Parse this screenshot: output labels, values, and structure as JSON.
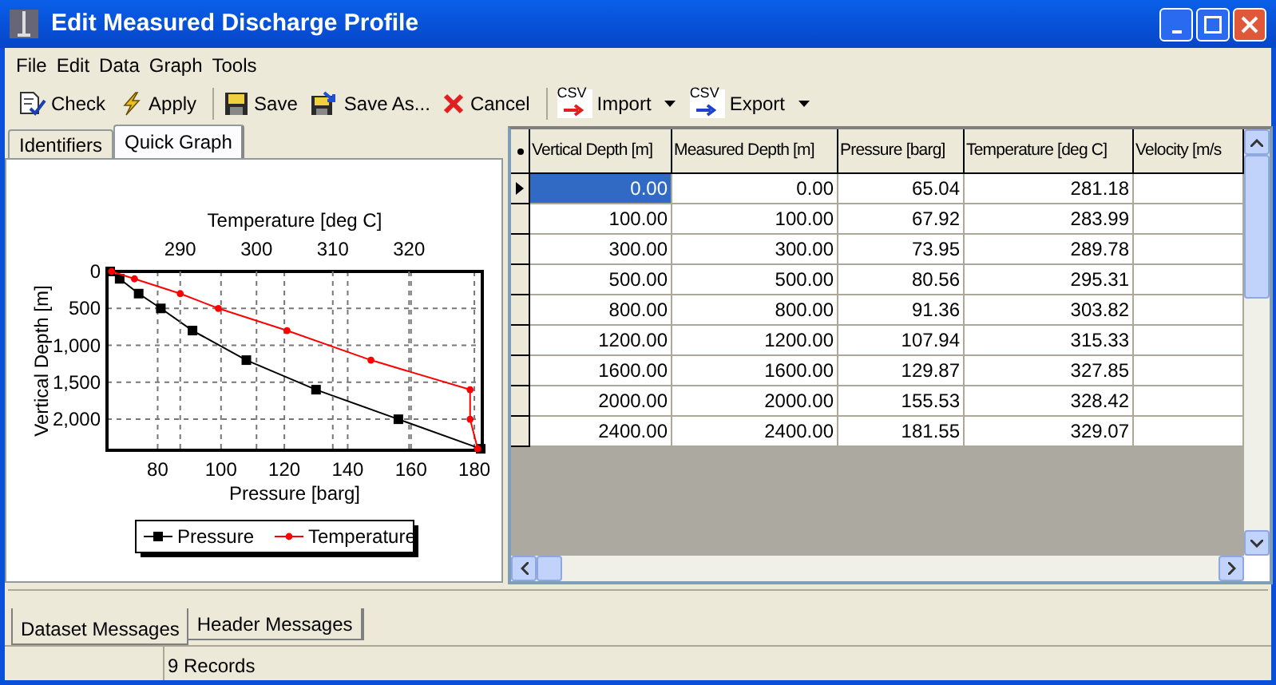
{
  "window": {
    "title": "Edit Measured Discharge Profile"
  },
  "menu": [
    "File",
    "Edit",
    "Data",
    "Graph",
    "Tools"
  ],
  "toolbar": [
    {
      "kind": "check",
      "label": "Check",
      "separator_before": false,
      "dropdown": false
    },
    {
      "kind": "apply",
      "label": "Apply",
      "separator_before": false,
      "dropdown": false
    },
    {
      "kind": "save",
      "label": "Save",
      "separator_before": true,
      "dropdown": false
    },
    {
      "kind": "saveas",
      "label": "Save As...",
      "separator_before": false,
      "dropdown": false
    },
    {
      "kind": "cancel",
      "label": "Cancel",
      "separator_before": false,
      "dropdown": false
    },
    {
      "kind": "import",
      "label": "Import",
      "icon_text": "CSV",
      "separator_before": true,
      "dropdown": true
    },
    {
      "kind": "export",
      "label": "Export",
      "icon_text": "CSV",
      "separator_before": false,
      "dropdown": true
    }
  ],
  "left_tabs": [
    {
      "label": "Identifiers",
      "selected": false
    },
    {
      "label": "Quick Graph",
      "selected": true
    }
  ],
  "graph": {
    "charts": [
      {
        "chart_data": {
          "type": "line",
          "orientation": "horizontal",
          "grid": true,
          "legend": true,
          "ylabel": "Vertical Depth [m]",
          "xlabel": "Pressure [barg]",
          "x": [
            0,
            100,
            300,
            500,
            800,
            1200,
            1600,
            2000,
            2400
          ],
          "series": [
            {
              "name": "Pressure",
              "color": "#000000",
              "marker": "square",
              "values": [
                65,
                68,
                74,
                81,
                91,
                108,
                130,
                156,
                182
              ]
            }
          ],
          "xlim": [
            64,
            182.5
          ],
          "ylim": [
            2420,
            0
          ],
          "xticks": [
            80,
            100,
            120,
            140,
            160,
            180
          ],
          "yticks": [
            {
              "value": 0,
              "label": "0"
            },
            {
              "value": 500,
              "label": "500"
            },
            {
              "value": 1000,
              "label": "1,000"
            },
            {
              "value": 1500,
              "label": "1,500"
            },
            {
              "value": 2000,
              "label": "2,000"
            }
          ]
        }
      },
      {
        "chart_data": {
          "type": "line",
          "orientation": "horizontal",
          "grid": true,
          "legend": true,
          "xlabel": "Temperature [deg C]",
          "x": [
            0,
            100,
            300,
            500,
            800,
            1200,
            1600,
            2000,
            2400
          ],
          "series": [
            {
              "name": "Temperature",
              "color": "#ff0000",
              "marker": "circle",
              "values": [
                281,
                284,
                290,
                295,
                304,
                315,
                328,
                328,
                329
              ]
            }
          ],
          "xlim": [
            280.4,
            329.6
          ],
          "ylim": [
            2420,
            0
          ],
          "xticks": [
            290,
            300,
            310,
            320
          ]
        }
      }
    ]
  },
  "table": {
    "columns": [
      "Vertical Depth [m]",
      "Measured Depth [m]",
      "Pressure [barg]",
      "Temperature [deg C]",
      "Velocity [m/s"
    ],
    "rows": [
      {
        "selected": true,
        "cells": [
          "0.00",
          "0.00",
          "65.04",
          "281.18"
        ]
      },
      {
        "selected": false,
        "cells": [
          "100.00",
          "100.00",
          "67.92",
          "283.99"
        ]
      },
      {
        "selected": false,
        "cells": [
          "300.00",
          "300.00",
          "73.95",
          "289.78"
        ]
      },
      {
        "selected": false,
        "cells": [
          "500.00",
          "500.00",
          "80.56",
          "295.31"
        ]
      },
      {
        "selected": false,
        "cells": [
          "800.00",
          "800.00",
          "91.36",
          "303.82"
        ]
      },
      {
        "selected": false,
        "cells": [
          "1200.00",
          "1200.00",
          "107.94",
          "315.33"
        ]
      },
      {
        "selected": false,
        "cells": [
          "1600.00",
          "1600.00",
          "129.87",
          "327.85"
        ]
      },
      {
        "selected": false,
        "cells": [
          "2000.00",
          "2000.00",
          "155.53",
          "328.42"
        ]
      },
      {
        "selected": false,
        "cells": [
          "2400.00",
          "2400.00",
          "181.55",
          "329.07"
        ]
      }
    ]
  },
  "message_tabs": [
    {
      "label": "Dataset Messages",
      "selected": true
    },
    {
      "label": "Header Messages",
      "selected": false
    }
  ],
  "status_bar": {
    "record_count": "9 Records"
  }
}
